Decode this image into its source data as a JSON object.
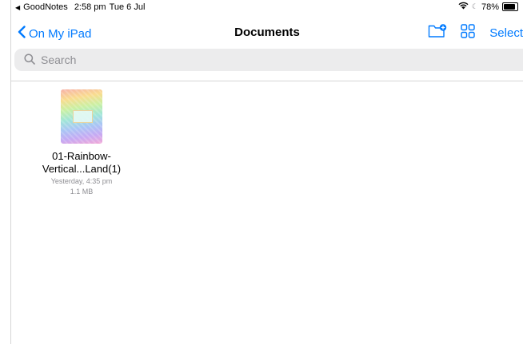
{
  "status_bar": {
    "app_back": "GoodNotes",
    "time": "2:58 pm",
    "date": "Tue 6 Jul",
    "battery": "78%",
    "battery_level": 0.78
  },
  "nav": {
    "back_label": "On My iPad",
    "title": "Documents",
    "select_label": "Select",
    "new_folder_icon": "folder-plus-icon",
    "grid_icon": "grid-view-icon"
  },
  "search": {
    "placeholder": "Search"
  },
  "colors": {
    "accent": "#007aff",
    "secondary_text": "#8e8e93",
    "search_bg": "#ececed"
  },
  "files": [
    {
      "name_line1": "01-Rainbow-",
      "name_line2": "Vertical...Land(1)",
      "modified": "Yesterday, 4:35 pm",
      "size": "1.1 MB"
    }
  ]
}
